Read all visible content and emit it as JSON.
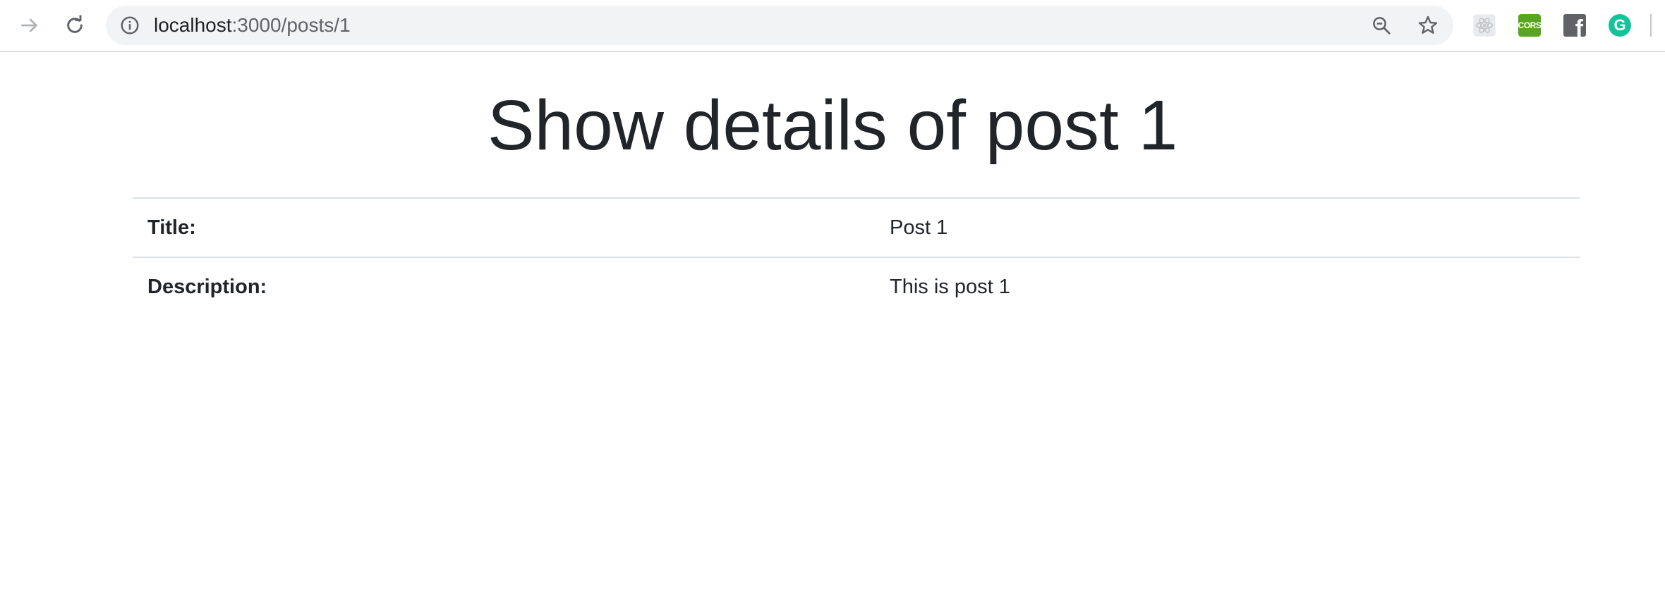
{
  "browser": {
    "url_host": "localhost",
    "url_path": ":3000/posts/1",
    "extensions": {
      "cors_label": "CORS",
      "facebook_label": "f",
      "grammarly_label": "G"
    }
  },
  "page": {
    "title": "Show details of post 1",
    "details": [
      {
        "label": "Title:",
        "value": "Post 1"
      },
      {
        "label": "Description:",
        "value": "This is post 1"
      }
    ]
  },
  "colors": {
    "text": "#212529",
    "table_border": "#dee2e6",
    "omnibox_bg": "#f1f3f4",
    "cors_green": "#5aa51f",
    "grammarly_green": "#15c39a"
  },
  "icons": {
    "forward": "arrow-forward-icon",
    "reload": "reload-icon",
    "info": "info-icon",
    "zoom": "zoom-out-icon",
    "bookmark": "star-icon"
  }
}
